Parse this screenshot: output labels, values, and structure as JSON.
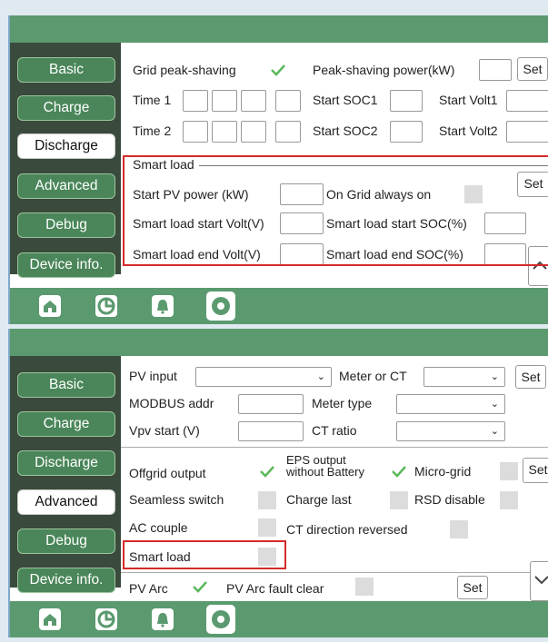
{
  "nav": [
    "Basic",
    "Charge",
    "Discharge",
    "Advanced",
    "Debug",
    "Device info."
  ],
  "panel1": {
    "active_nav": "Discharge",
    "grid_peak_shaving": "Grid peak-shaving",
    "peak_shaving_power": "Peak-shaving power(kW)",
    "set": "Set",
    "time1": "Time 1",
    "time2": "Time 2",
    "start_soc1": "Start SOC1",
    "start_volt1": "Start Volt1",
    "start_soc2": "Start SOC2",
    "start_volt2": "Start Volt2",
    "smart_load_group": "Smart load",
    "start_pv_power": "Start PV power (kW)",
    "on_grid_always_on": "On Grid always on",
    "sl_start_volt": "Smart load start Volt(V)",
    "sl_start_soc": "Smart load start SOC(%)",
    "sl_end_volt": "Smart load end Volt(V)",
    "sl_end_soc": "Smart load end SOC(%)"
  },
  "panel2": {
    "active_nav": "Advanced",
    "pv_input": "PV input",
    "meter_or_ct": "Meter or CT",
    "modbus_addr": "MODBUS addr",
    "meter_type": "Meter type",
    "vpv_start": "Vpv start (V)",
    "ct_ratio": "CT ratio",
    "set": "Set",
    "offgrid_output": "Offgrid output",
    "eps_output_line1": "EPS output",
    "eps_output_line2": "without Battery",
    "micro_grid": "Micro-grid",
    "seamless_switch": "Seamless switch",
    "charge_last": "Charge last",
    "rsd_disable": "RSD disable",
    "ac_couple": "AC couple",
    "ct_direction_reversed": "CT direction reversed",
    "smart_load": "Smart load",
    "pv_arc": "PV Arc",
    "pv_arc_fault_clear": "PV Arc fault clear"
  },
  "icons": [
    "home-icon",
    "pie-chart-icon",
    "bell-icon",
    "settings-gear-icon"
  ],
  "colors": {
    "green": "#5a9a6e",
    "sidebar": "#3a4a3c",
    "highlight": "#d42a2a"
  }
}
